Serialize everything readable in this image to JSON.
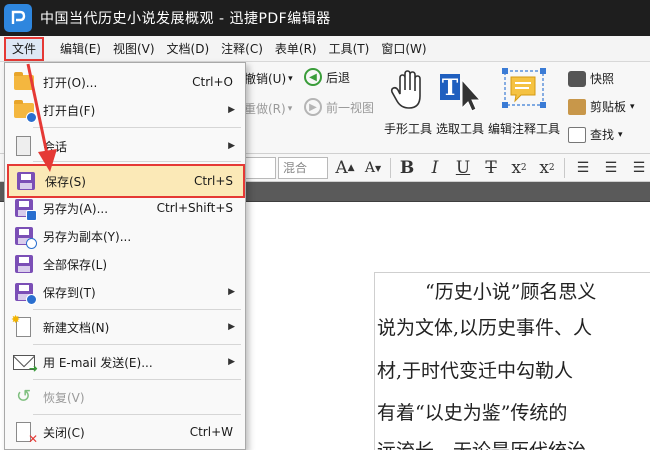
{
  "window": {
    "title": "中国当代历史小说发展概观 - 迅捷PDF编辑器"
  },
  "menubar": {
    "items": [
      {
        "key": "file",
        "label": "文件"
      },
      {
        "key": "edit",
        "label": "编辑(E)"
      },
      {
        "key": "view",
        "label": "视图(V)"
      },
      {
        "key": "document",
        "label": "文档(D)"
      },
      {
        "key": "comment",
        "label": "注释(C)"
      },
      {
        "key": "form",
        "label": "表单(R)"
      },
      {
        "key": "tools",
        "label": "工具(T)"
      },
      {
        "key": "window",
        "label": "窗口(W)"
      }
    ]
  },
  "ribbon": {
    "undo": "撤销(U)",
    "redo": "重做(R)",
    "back": "后退",
    "forward": "前一视图",
    "hand_tool": "手形工具",
    "select_tool": "选取工具",
    "edit_annot_tool": "编辑注释工具",
    "snapshot": "快照",
    "clipboard": "剪贴板",
    "find": "查找"
  },
  "formatbar": {
    "font_mode": "混合"
  },
  "file_menu": {
    "items": [
      {
        "label": "打开(O)...",
        "shortcut": "Ctrl+O"
      },
      {
        "label": "打开自(F)"
      },
      {
        "label": "会话"
      },
      {
        "label": "保存(S)",
        "shortcut": "Ctrl+S"
      },
      {
        "label": "另存为(A)...",
        "shortcut": "Ctrl+Shift+S"
      },
      {
        "label": "另存为副本(Y)..."
      },
      {
        "label": "全部保存(L)"
      },
      {
        "label": "保存到(T)"
      },
      {
        "label": "新建文档(N)"
      },
      {
        "label": "用 E-mail 发送(E)..."
      },
      {
        "label": "恢复(V)"
      },
      {
        "label": "关闭(C)",
        "shortcut": "Ctrl+W"
      }
    ]
  },
  "document": {
    "lines": [
      "“历史小说”顾名思义",
      "说为文体,以历史事件、人",
      "材,于时代变迁中勾勒人",
      "有着“以史为鉴”传统的",
      "远流长。无论是历代统治"
    ]
  },
  "colors": {
    "titlebar": "#1e1e1e",
    "highlight_border": "#e53935",
    "highlight_fill": "#fbe9b7"
  }
}
